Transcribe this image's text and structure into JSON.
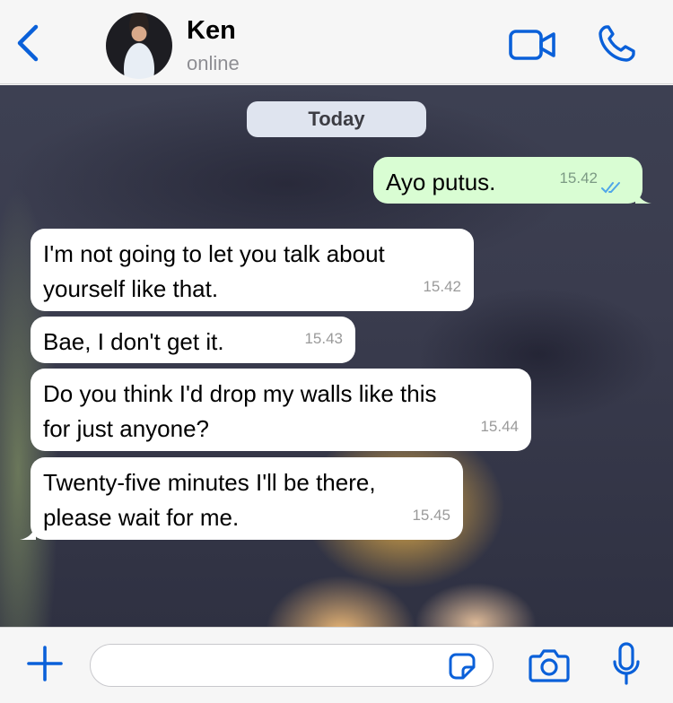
{
  "header": {
    "contact_name": "Ken",
    "status": "online"
  },
  "chat": {
    "date_label": "Today",
    "messages": [
      {
        "direction": "outgoing",
        "text": "Ayo putus.",
        "time": "15.42",
        "read": true
      },
      {
        "direction": "incoming",
        "lines": [
          "I'm not going to let you talk about",
          "yourself like that."
        ],
        "time": "15.42"
      },
      {
        "direction": "incoming",
        "text": "Bae, I don't get it.",
        "time": "15.43"
      },
      {
        "direction": "incoming",
        "lines": [
          "Do you think I'd drop my walls like this",
          "for just anyone?"
        ],
        "time": "15.44"
      },
      {
        "direction": "incoming",
        "lines": [
          "Twenty-five minutes I'll be there,",
          "please wait for me."
        ],
        "time": "15.45"
      }
    ]
  },
  "input": {
    "value": "",
    "placeholder": ""
  },
  "colors": {
    "accent": "#0a60d9",
    "outgoing_bubble": "#d9fdd3",
    "incoming_bubble": "#ffffff",
    "read_ticks": "#4fa6e8"
  },
  "icons": {
    "back": "chevron-left-icon",
    "video": "video-camera-icon",
    "call": "phone-icon",
    "plus": "plus-icon",
    "sticker": "sticker-icon",
    "camera": "camera-icon",
    "mic": "microphone-icon"
  }
}
